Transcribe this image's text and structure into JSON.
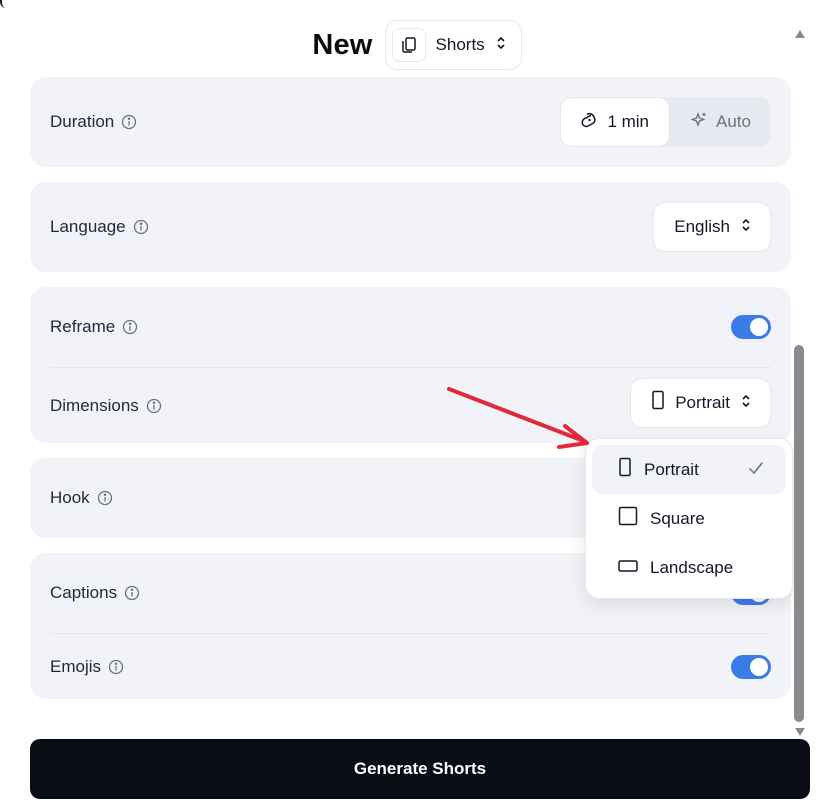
{
  "header": {
    "title": "New",
    "type_label": "Shorts",
    "type_icon": "copy-icon"
  },
  "duration": {
    "label": "Duration",
    "options": [
      {
        "label": "1 min",
        "icon": "clip-icon",
        "active": true
      },
      {
        "label": "Auto",
        "icon": "sparkle-icon",
        "active": false
      }
    ]
  },
  "language": {
    "label": "Language",
    "value": "English"
  },
  "reframe": {
    "label": "Reframe",
    "enabled": true
  },
  "dimensions": {
    "label": "Dimensions",
    "value": "Portrait",
    "icon": "portrait-icon"
  },
  "hook": {
    "label": "Hook"
  },
  "captions": {
    "label": "Captions"
  },
  "emojis": {
    "label": "Emojis",
    "enabled": true
  },
  "dimensions_menu": [
    {
      "label": "Portrait",
      "icon": "portrait-icon",
      "selected": true
    },
    {
      "label": "Square",
      "icon": "square-icon",
      "selected": false
    },
    {
      "label": "Landscape",
      "icon": "landscape-icon",
      "selected": false
    }
  ],
  "footer": {
    "generate_label": "Generate Shorts"
  },
  "colors": {
    "accent": "#3b7be8",
    "card_bg": "#f1f3f8",
    "button_bg": "#0a0d16",
    "annotation_arrow": "#e3283a"
  }
}
